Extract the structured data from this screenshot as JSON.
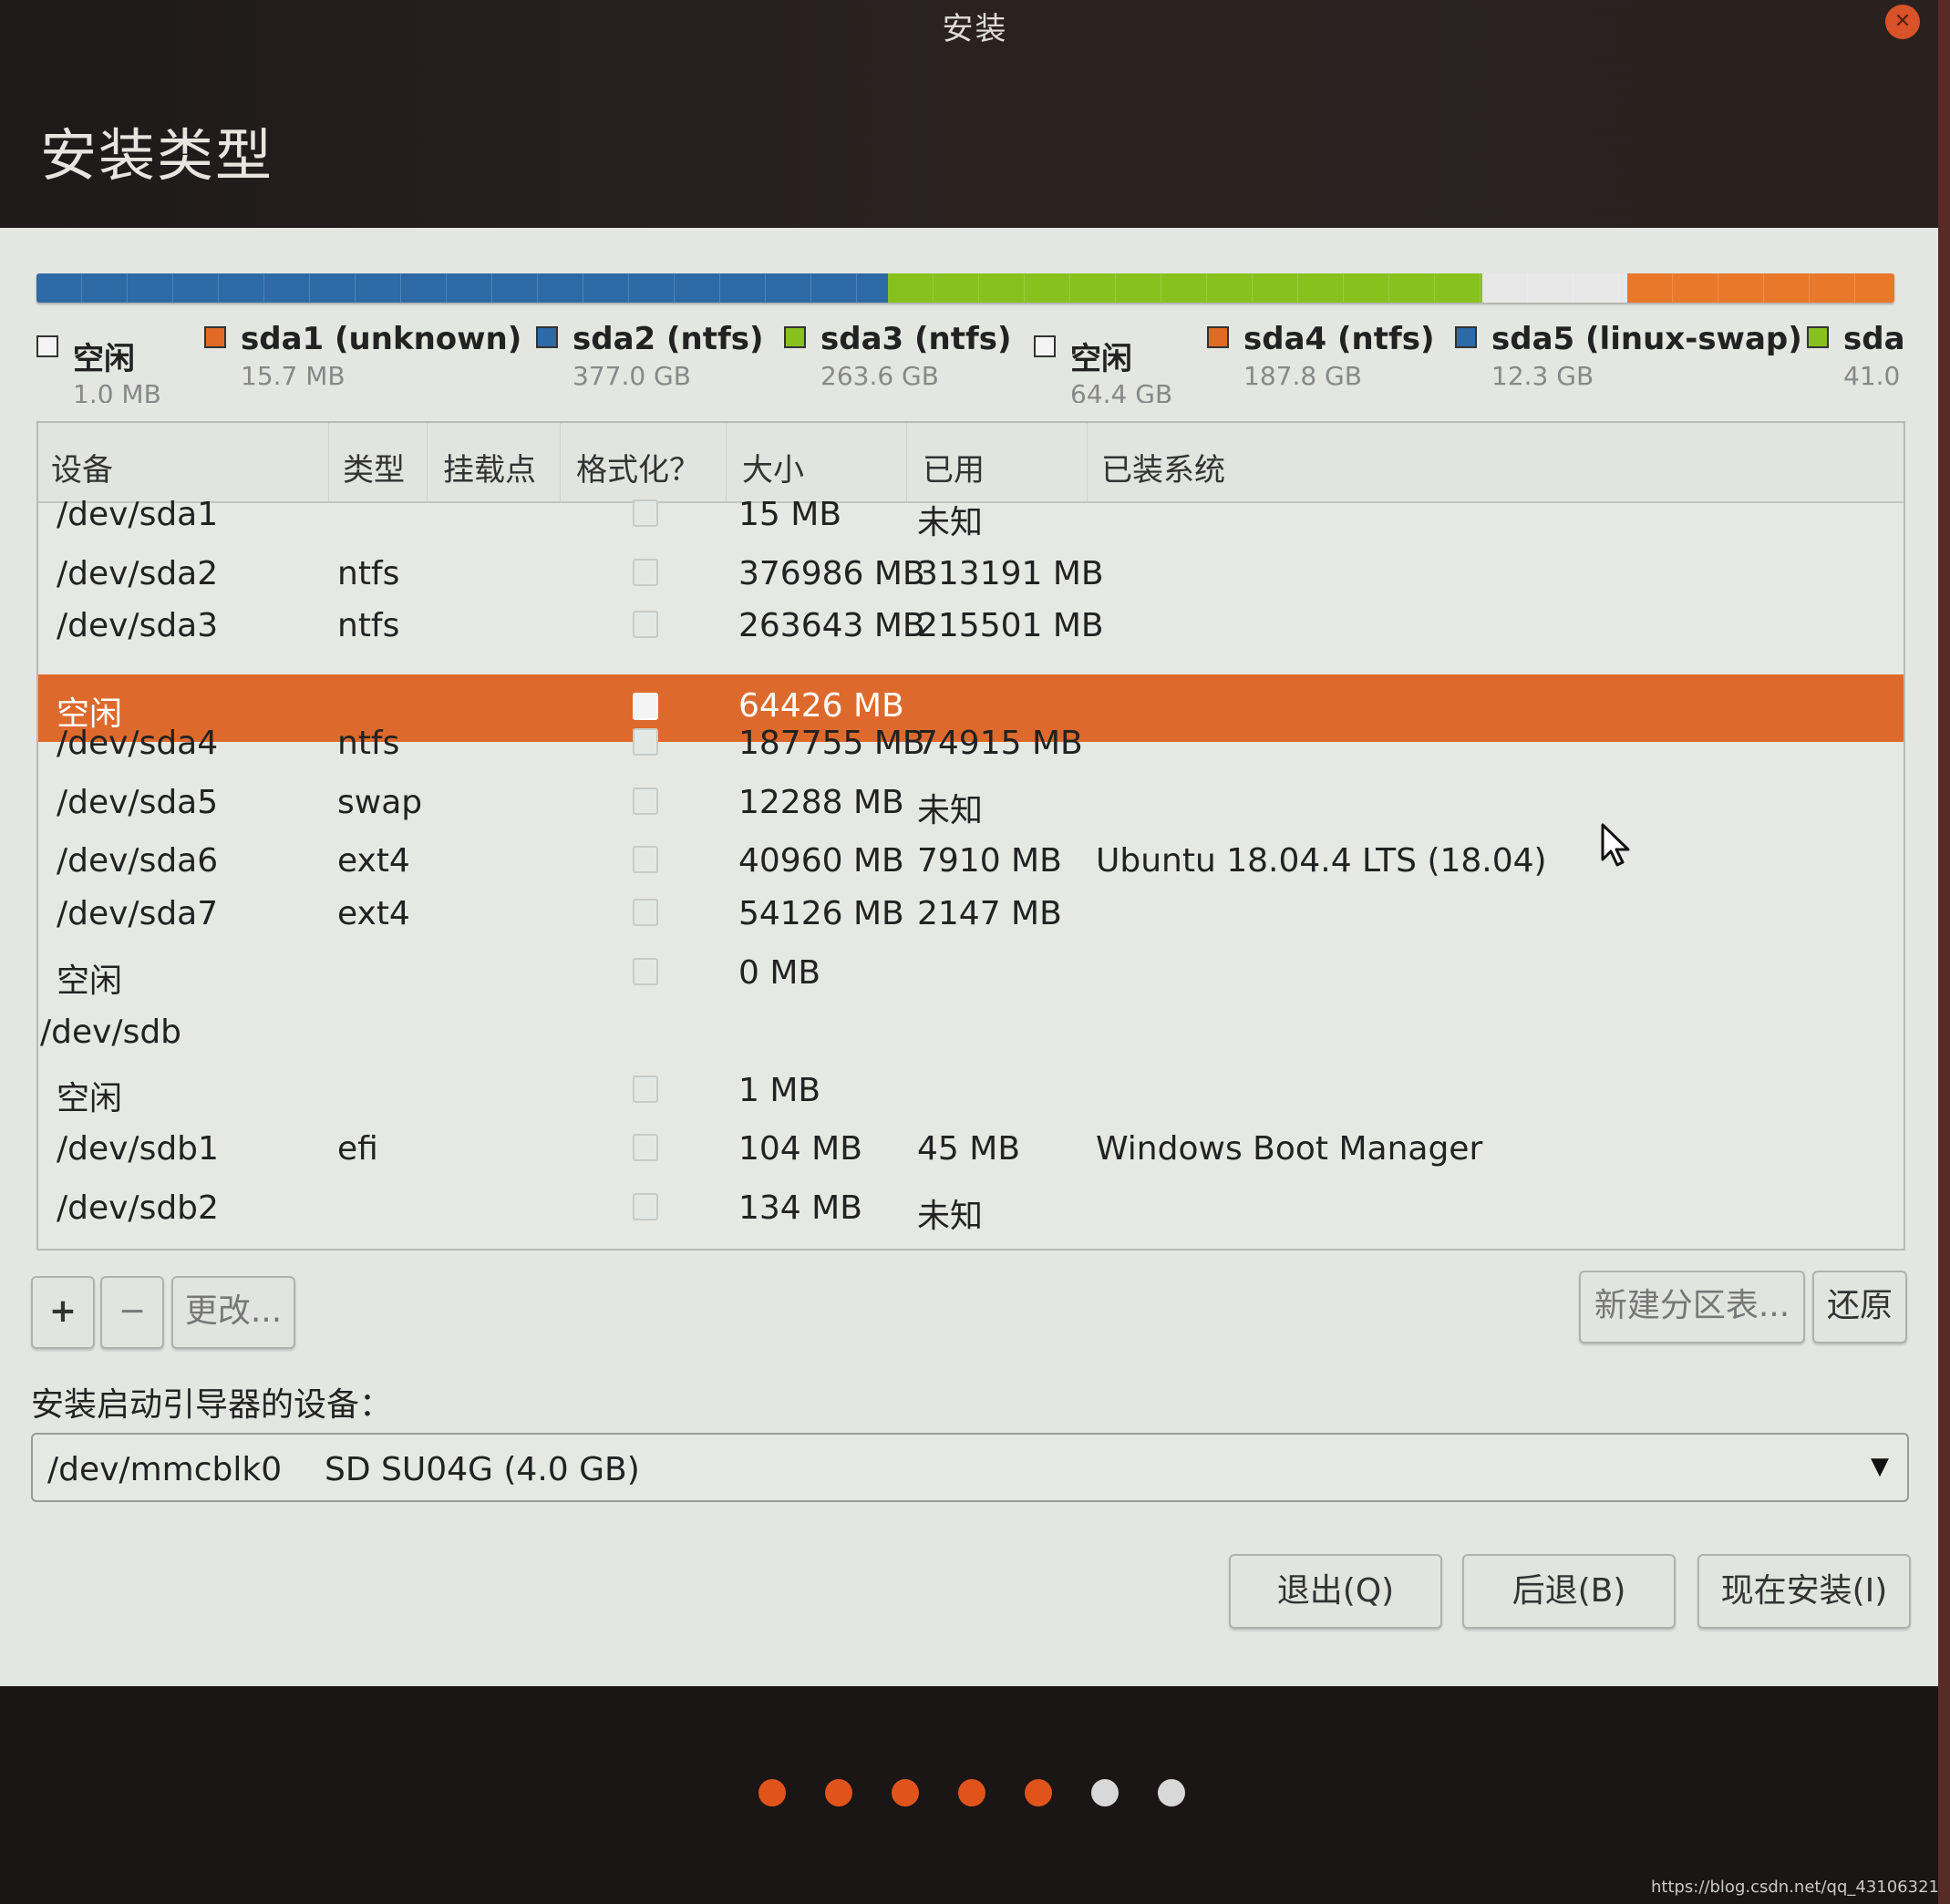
{
  "window": {
    "title": "安装",
    "close_icon": "close-icon"
  },
  "page": {
    "title": "安装类型"
  },
  "partition_bar": {
    "segments": [
      {
        "name": "sda1",
        "color": "#e06a26",
        "fraction": 0.0001
      },
      {
        "name": "sda2",
        "color": "#2e6aa6",
        "fraction": 0.458
      },
      {
        "name": "sda3",
        "color": "#86c11e",
        "fraction": 0.32
      },
      {
        "name": "free",
        "color": "#e8e8e8",
        "fraction": 0.078
      },
      {
        "name": "sda4",
        "color": "#e9782a",
        "fraction": 0.144
      }
    ]
  },
  "legend": [
    {
      "name": "空闲",
      "size": "1.0 MB",
      "color": "#f4f4f4"
    },
    {
      "name": "sda1 (unknown)",
      "size": "15.7 MB",
      "color": "#e06a26"
    },
    {
      "name": "sda2 (ntfs)",
      "size": "377.0 GB",
      "color": "#2e6aa6"
    },
    {
      "name": "sda3 (ntfs)",
      "size": "263.6 GB",
      "color": "#86c11e"
    },
    {
      "name": "空闲",
      "size": "64.4 GB",
      "color": "#f4f4f4"
    },
    {
      "name": "sda4 (ntfs)",
      "size": "187.8 GB",
      "color": "#e06a26"
    },
    {
      "name": "sda5 (linux-swap)",
      "size": "12.3 GB",
      "color": "#2e6aa6"
    },
    {
      "name": "sda",
      "size": "41.0",
      "color": "#86c11e"
    }
  ],
  "table": {
    "columns": [
      "设备",
      "类型",
      "挂载点",
      "格式化？",
      "大小",
      "已用",
      "已装系统"
    ],
    "rows": [
      {
        "device": "/dev/sda1",
        "type": "",
        "mount": "",
        "format": false,
        "size": "15 MB",
        "used": "未知",
        "system": ""
      },
      {
        "device": "/dev/sda2",
        "type": "ntfs",
        "mount": "",
        "format": false,
        "size": "376986 MB",
        "used": "313191 MB",
        "system": ""
      },
      {
        "device": "/dev/sda3",
        "type": "ntfs",
        "mount": "",
        "format": false,
        "size": "263643 MB",
        "used": "215501 MB",
        "system": ""
      },
      {
        "device": "空闲",
        "type": "",
        "mount": "",
        "format": false,
        "size": "64426 MB",
        "used": "",
        "system": "",
        "selected": true
      },
      {
        "device": "/dev/sda4",
        "type": "ntfs",
        "mount": "",
        "format": false,
        "size": "187755 MB",
        "used": "74915 MB",
        "system": ""
      },
      {
        "device": "/dev/sda5",
        "type": "swap",
        "mount": "",
        "format": false,
        "size": "12288 MB",
        "used": "未知",
        "system": ""
      },
      {
        "device": "/dev/sda6",
        "type": "ext4",
        "mount": "",
        "format": false,
        "size": "40960 MB",
        "used": "7910 MB",
        "system": "Ubuntu 18.04.4 LTS (18.04)"
      },
      {
        "device": "/dev/sda7",
        "type": "ext4",
        "mount": "",
        "format": false,
        "size": "54126 MB",
        "used": "2147 MB",
        "system": ""
      },
      {
        "device": "空闲",
        "type": "",
        "mount": "",
        "format": false,
        "size": "0 MB",
        "used": "",
        "system": ""
      },
      {
        "device": "/dev/sdb",
        "type": "",
        "mount": "",
        "size": "",
        "used": "",
        "system": "",
        "disk": true
      },
      {
        "device": "空闲",
        "type": "",
        "mount": "",
        "format": false,
        "size": "1 MB",
        "used": "",
        "system": ""
      },
      {
        "device": "/dev/sdb1",
        "type": "efi",
        "mount": "",
        "format": false,
        "size": "104 MB",
        "used": "45 MB",
        "system": "Windows Boot Manager"
      },
      {
        "device": "/dev/sdb2",
        "type": "",
        "mount": "",
        "format": false,
        "size": "134 MB",
        "used": "未知",
        "system": ""
      }
    ]
  },
  "table_actions": {
    "add": "+",
    "remove": "−",
    "change": "更改...",
    "new_table": "新建分区表...",
    "revert": "还原"
  },
  "bootloader": {
    "label": "安装启动引导器的设备：",
    "device": "/dev/mmcblk0",
    "description": "SD SU04G (4.0 GB)",
    "arrow": "▼"
  },
  "footer_buttons": {
    "quit": "退出(Q)",
    "back": "后退(B)",
    "install": "现在安装(I)"
  },
  "progress": {
    "total_steps": 7,
    "completed_steps": 5,
    "active_color": "#e0541c",
    "inactive_color": "#d8d8d8"
  },
  "watermark": "https://blog.csdn.net/qq_43106321"
}
